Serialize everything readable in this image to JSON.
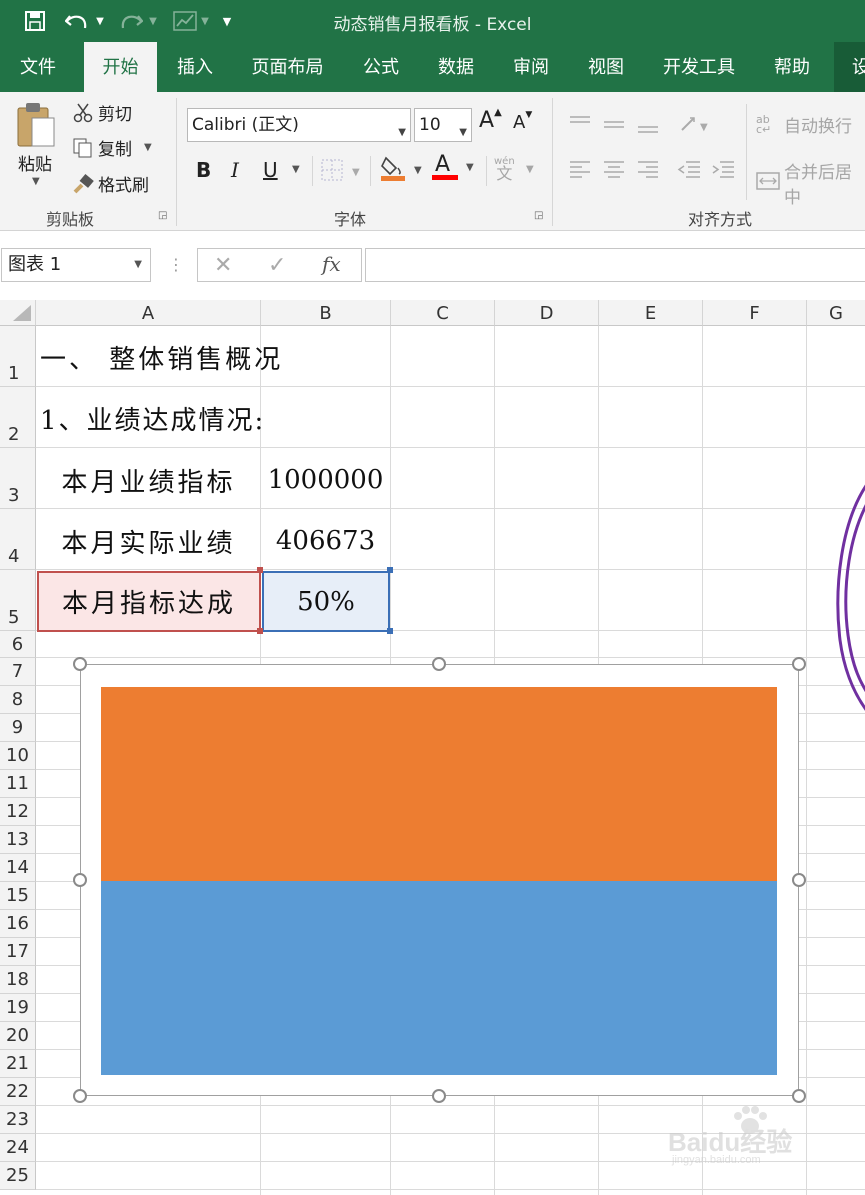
{
  "titlebar": {
    "title": "动态销售月报看板  -  Excel",
    "save_icon": "save-icon",
    "undo_icon": "undo-icon",
    "redo_icon": "redo-icon",
    "customize_icon": "customize-quick-access-icon"
  },
  "tabs": [
    "文件",
    "开始",
    "插入",
    "页面布局",
    "公式",
    "数据",
    "审阅",
    "视图",
    "开发工具",
    "帮助",
    "设"
  ],
  "active_tab": "开始",
  "ribbon": {
    "clipboard": {
      "paste": "粘贴",
      "cut": "剪切",
      "copy": "复制",
      "format_painter": "格式刷",
      "group": "剪贴板"
    },
    "font": {
      "font_name": "Calibri (正文)",
      "font_size": "10",
      "grow": "A",
      "shrink": "A",
      "bold": "B",
      "italic": "I",
      "underline": "U",
      "font_color_glyph": "A",
      "phonetic": "wén",
      "phonetic2": "文",
      "group": "字体",
      "fill_color": "#ed7d31",
      "font_color": "#ff0000"
    },
    "alignment": {
      "wrap_text": "自动换行",
      "merge_center": "合并后居中",
      "group": "对齐方式"
    }
  },
  "formula_bar": {
    "name_box": "图表 1",
    "fx": "fx",
    "formula": ""
  },
  "columns": [
    "A",
    "B",
    "C",
    "D",
    "E",
    "F",
    "G"
  ],
  "rows": [
    "1",
    "2",
    "3",
    "4",
    "5",
    "6",
    "7",
    "8",
    "9",
    "10",
    "11",
    "12",
    "13",
    "14",
    "15",
    "16",
    "17",
    "18",
    "19",
    "20",
    "21",
    "22",
    "23",
    "24",
    "25"
  ],
  "cells": {
    "A1": "一、 整体销售概况",
    "A2": "1、业绩达成情况:",
    "A3": "本月业绩指标",
    "B3": "1000000",
    "A4": "本月实际业绩",
    "B4": "406673",
    "A5": "本月指标达成",
    "B5": "50%"
  },
  "chart": {
    "top_color": "#ed7d31",
    "bottom_color": "#5b9bd5"
  },
  "watermark": {
    "brand": "Baidu经验",
    "url": "jingyan.baidu.com"
  }
}
